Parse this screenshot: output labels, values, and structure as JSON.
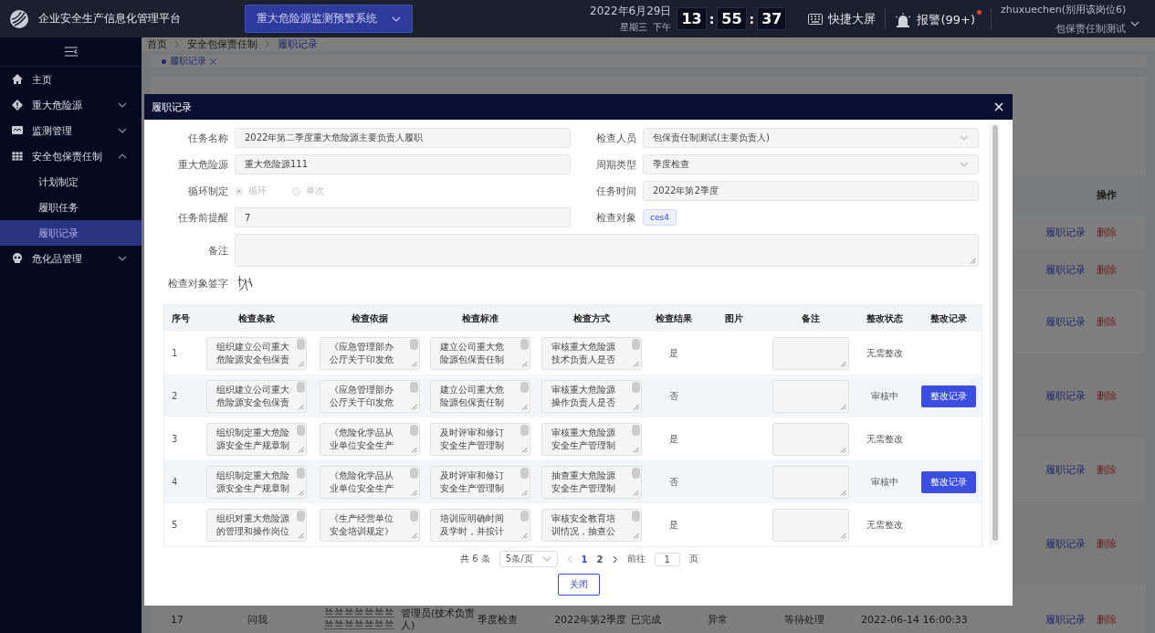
{
  "topbar": {
    "title": "企业安全生产信息化管理平台",
    "system": "重大危险源监测预警系统",
    "date": "2022年6月29日",
    "weekday": "星期三  下午",
    "clock": [
      "13",
      "55",
      "37"
    ],
    "clock_separator": ":",
    "big_screen": "快捷大屏",
    "alarm": "报警(99+)",
    "alarm_dot": true,
    "user": "zhuxuechen(别用该岗位6)",
    "role": "包保责任制测试"
  },
  "sidebar": {
    "items": [
      {
        "label": "主页",
        "selected": false
      },
      {
        "label": "重大危险源",
        "selected": false,
        "expanded": false
      },
      {
        "label": "监测管理",
        "selected": false,
        "expanded": false
      },
      {
        "label": "安全包保责任制",
        "selected": false,
        "expanded": true,
        "children": [
          {
            "label": "计划制定",
            "selected": false
          },
          {
            "label": "履职任务",
            "selected": false
          },
          {
            "label": "履职记录",
            "selected": true
          }
        ]
      },
      {
        "label": "危化品管理",
        "selected": false,
        "expanded": false
      }
    ]
  },
  "breadcrumb": [
    "首页",
    "安全包保责任制",
    "履职记录"
  ],
  "tabs": [
    {
      "label": "履职记录",
      "selected": true
    }
  ],
  "background_table": {
    "action_header": "操作",
    "rows": [
      {
        "actions": [
          "履职记录",
          "删除"
        ]
      },
      {
        "actions": [
          "履职记录",
          "删除"
        ]
      },
      {
        "actions": [
          "履职记录",
          "删除"
        ]
      },
      {
        "actions": [
          "履职记录",
          "删除"
        ]
      },
      {
        "actions": [
          "履职记录",
          "删除"
        ]
      },
      {
        "actions": [
          "履职记录",
          "删除"
        ]
      },
      {
        "cells": [
          "17",
          "问我",
          "兰兰兰兰兰兰兰兰兰兰兰兰兰兰",
          "管理员(技术负责人)",
          "季度检查",
          "2022年第2季度",
          "已完成",
          "异常",
          "等待处理",
          "2022-06-14 16:00:33"
        ],
        "actions": [
          "履职记录",
          "删除"
        ]
      }
    ]
  },
  "dialog": {
    "title": "履职记录",
    "fields": [
      {
        "label": "任务名称",
        "kind": "text",
        "value": "2022年第二季度重大危险源主要负责人履职"
      },
      {
        "label": "检查人员",
        "kind": "select",
        "value": "包保责任制测试(主要负责人)"
      },
      {
        "label": "重大危险源",
        "kind": "text",
        "value": "重大危险源111"
      },
      {
        "label": "周期类型",
        "kind": "select",
        "value": "季度检查"
      },
      {
        "label": "循环制定",
        "kind": "radio",
        "options": [
          {
            "label": "循环",
            "selected": true
          },
          {
            "label": "单次",
            "selected": false
          }
        ]
      },
      {
        "label": "任务时间",
        "kind": "text",
        "value": "2022年第2季度"
      },
      {
        "label": "任务前提醒",
        "kind": "text",
        "value": "7"
      },
      {
        "label": "检查对象",
        "kind": "tags",
        "tags": [
          "ces4"
        ]
      },
      {
        "label": "备注",
        "kind": "textarea"
      },
      {
        "label": "检查对象签字",
        "kind": "signature"
      }
    ],
    "table": {
      "columns": [
        "序号",
        "检查条款",
        "检查依据",
        "检查标准",
        "检查方式",
        "检查结果",
        "图片",
        "备注",
        "整改状态",
        "整改记录"
      ],
      "rows": [
        {
          "no": "1",
          "clause": [
            "组织建立公司重大",
            "危险源安全包保责"
          ],
          "basis": [
            "《应急管理部办",
            "公厅关于印发危"
          ],
          "standard": [
            "建立公司重大危",
            "险源包保责任制"
          ],
          "method": [
            "审核重大危险源",
            "技术负责人是否"
          ],
          "result": "是",
          "status": "无需整改"
        },
        {
          "no": "2",
          "clause": [
            "组织建立公司重大",
            "危险源安全包保责"
          ],
          "basis": [
            "《应急管理部办",
            "公厅关于印发危"
          ],
          "standard": [
            "建立公司重大危",
            "险源包保责任制"
          ],
          "method": [
            "审核重大危险源",
            "操作负责人是否"
          ],
          "result": "否",
          "status": "审核中",
          "action": "整改记录"
        },
        {
          "no": "3",
          "clause": [
            "组织制定重大危险",
            "源安全生产规章制"
          ],
          "basis": [
            "《危险化学品从",
            "业单位安全生产"
          ],
          "standard": [
            "及时评审和修订",
            "安全生产管理制"
          ],
          "method": [
            "审核重大危险源",
            "安全生产管理制"
          ],
          "result": "是",
          "status": "无需整改"
        },
        {
          "no": "4",
          "clause": [
            "组织制定重大危险",
            "源安全生产规章制"
          ],
          "basis": [
            "《危险化学品从",
            "业单位安全生产"
          ],
          "standard": [
            "及时评审和修订",
            "安全生产管理制"
          ],
          "method": [
            "抽查重大危险源",
            "安全生产管理制"
          ],
          "result": "否",
          "status": "审核中",
          "action": "整改记录"
        },
        {
          "no": "5",
          "clause": [
            "组织对重大危险源",
            "的管理和操作岗位"
          ],
          "basis": [
            "《生产经营单位",
            "安全培训规定》"
          ],
          "standard": [
            "培训应明确时间",
            "及学时，并按计"
          ],
          "method": [
            "审核安全教育培",
            "训情况，抽查公"
          ],
          "result": "是",
          "status": "无需整改"
        }
      ]
    },
    "pagination": {
      "total": "共 6 条",
      "page_size": "5条/页",
      "pages": [
        {
          "label": "1",
          "selected": true
        },
        {
          "label": "2",
          "selected": false
        }
      ],
      "goto_label": "前往",
      "goto_value": "1",
      "page_unit": "页"
    },
    "close_button": "关闭"
  }
}
